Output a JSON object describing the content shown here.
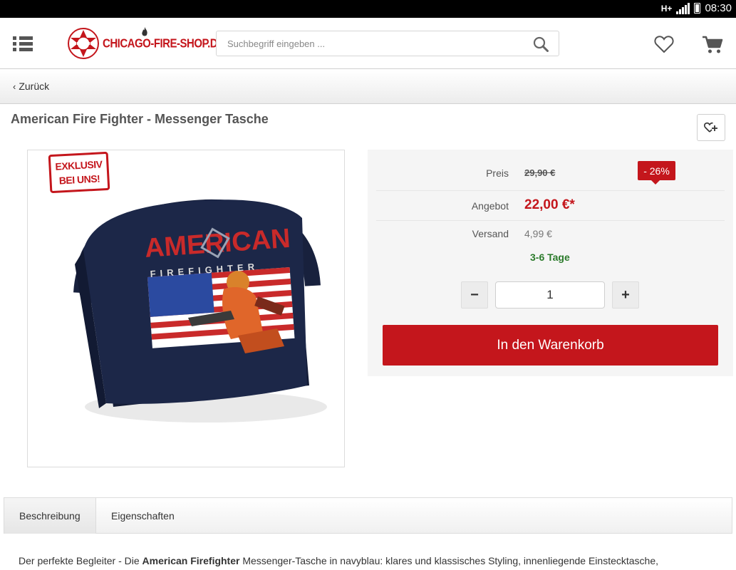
{
  "status_bar": {
    "network": "H+",
    "time": "08:30"
  },
  "header": {
    "logo_text": "CHICAGO-FIRE-SHOP.DE",
    "search_placeholder": "Suchbegriff eingeben ..."
  },
  "back_label": "Zurück",
  "product": {
    "title": "American Fire Fighter - Messenger Tasche",
    "badge": [
      "EXKLUSIV",
      "BEI UNS!"
    ],
    "image_print": [
      "AMERICAN",
      "FIREFIGHTER"
    ]
  },
  "buybox": {
    "price_label": "Preis",
    "price_old": "29,90 €",
    "discount": "- 26%",
    "offer_label": "Angebot",
    "offer_price": "22,00 €*",
    "shipping_label": "Versand",
    "shipping_price": "4,99 €",
    "delivery_time": "3-6 Tage",
    "quantity": "1",
    "qty_minus": "−",
    "qty_plus": "+",
    "add_to_cart": "In den Warenkorb"
  },
  "tabs": [
    "Beschreibung",
    "Eigenschaften"
  ],
  "description": {
    "intro": "Der perfekte Begleiter - Die ",
    "bold": "American Firefighter",
    "rest": " Messenger-Tasche in navyblau: klares und klassisches Styling, innenliegende Einstecktasche,"
  },
  "colors": {
    "brand_red": "#c4161c",
    "delivery_green": "#2a7a2a",
    "bag_navy": "#1c2748"
  }
}
